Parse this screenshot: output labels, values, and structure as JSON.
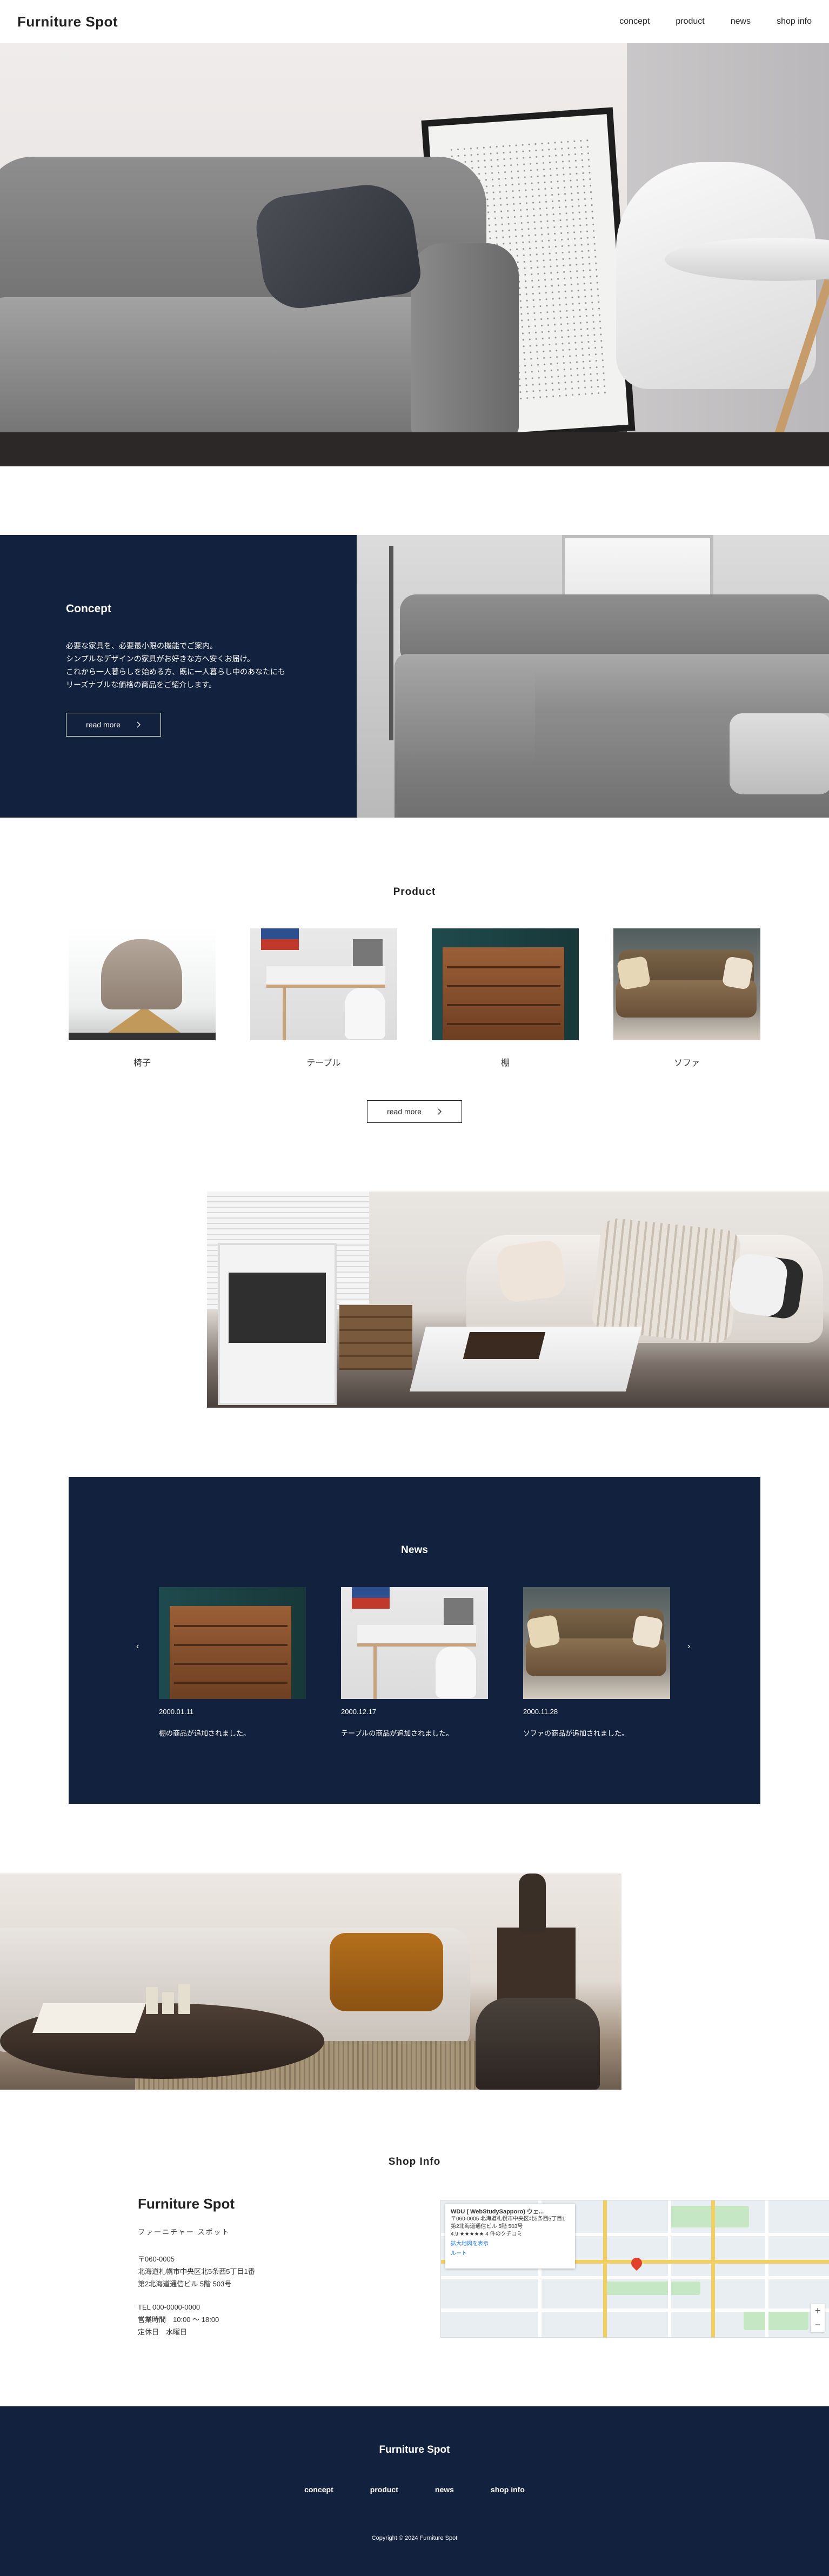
{
  "header": {
    "logo": "Furniture Spot",
    "nav": [
      "concept",
      "product",
      "news",
      "shop info"
    ]
  },
  "concept": {
    "title": "Concept",
    "text": [
      "必要な家具を、必要最小限の機能でご案内。",
      "シンプルなデザインの家具がお好きな方へ安くお届け。",
      "これから一人暮らしを始める方、既に一人暮らし中のあなたにも",
      "リーズナブルな価格の商品をご紹介します。"
    ],
    "button": "read more",
    "button_icon": "chevron-right-icon"
  },
  "product": {
    "title": "Product",
    "items": [
      "椅子",
      "テーブル",
      "棚",
      "ソファ"
    ],
    "button": "read more",
    "button_icon": "chevron-right-icon"
  },
  "news": {
    "title": "News",
    "prev": "‹",
    "next": "›",
    "items": [
      {
        "date": "2000.01.11",
        "title": "棚の商品が追加されました。"
      },
      {
        "date": "2000.12.17",
        "title": "テーブルの商品が追加されました。"
      },
      {
        "date": "2000.11.28",
        "title": "ソファの商品が追加されました。"
      }
    ]
  },
  "shop": {
    "title": "Shop Info",
    "name": "Furniture Spot",
    "kana": "ファーニチャー スポット",
    "zip": "〒060-0005",
    "address1": "北海道札幌市中央区北5条西5丁目1番",
    "address2": "第2北海道通信ビル 5階 503号",
    "tel": "TEL 000-0000-0000",
    "hours": "営業時間　10:00 〜 18:00",
    "closed": "定休日　水曜日",
    "map": {
      "card_title": "WDU ( WebStudySapporo) ウェ...",
      "card_address": "〒060-0005 北海道札幌市中央区北5条西5丁目1 第2北海道通信ビル 5階 503号",
      "rating": "4.9 ★★★★★ 4 件のクチコミ",
      "link": "拡大地図を表示",
      "route": "ルート"
    }
  },
  "footer": {
    "logo": "Furniture Spot",
    "nav": [
      "concept",
      "product",
      "news",
      "shop info"
    ],
    "copyright": "Copyright © 2024 Furniture Spot"
  },
  "colors": {
    "navy": "#12213d",
    "text": "#222222"
  }
}
